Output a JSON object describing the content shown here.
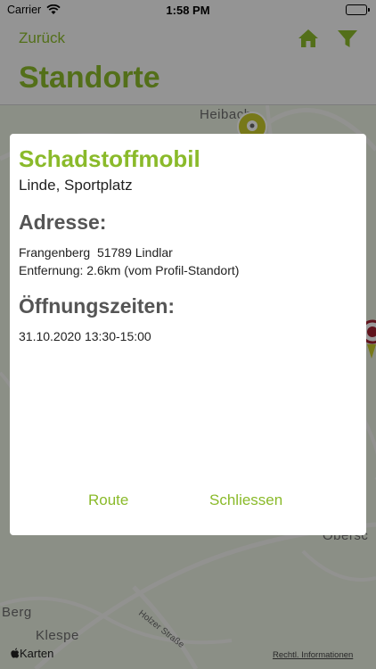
{
  "status_bar": {
    "carrier": "Carrier",
    "time": "1:58 PM"
  },
  "nav": {
    "back_label": "Zurück",
    "title": "Standorte",
    "icons": [
      "home-icon",
      "filter-icon"
    ]
  },
  "map": {
    "place_labels": [
      "Heibach",
      "Berg",
      "Klespe",
      "Obersc"
    ],
    "road_label": "Holzer Straße",
    "attribution": "Karten",
    "legal_link": "Rechtl. Informationen"
  },
  "dialog": {
    "title": "Schadstoffmobil",
    "subtitle": "Linde, Sportplatz",
    "address_heading": "Adresse:",
    "address_line": "Frangenberg  51789 Lindlar",
    "distance_line": "Entfernung: 2.6km (vom Profil-Standort)",
    "hours_heading": "Öffnungszeiten:",
    "hours_line": "31.10.2020 13:30-15:00",
    "route_button": "Route",
    "close_button": "Schliessen"
  },
  "colors": {
    "accent": "#8aba2a",
    "heading": "#555555",
    "overlay": "rgba(0,0,0,0.40)"
  }
}
